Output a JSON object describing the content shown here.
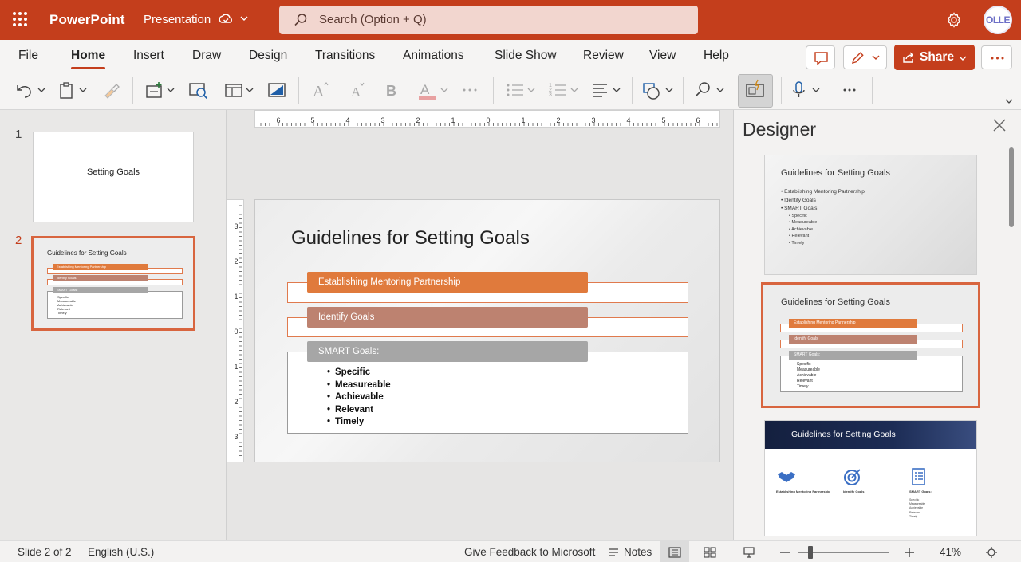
{
  "titlebar": {
    "app_name": "PowerPoint",
    "doc_name": "Presentation",
    "search_placeholder": "Search (Option + Q)",
    "avatar_initials": "OLLE",
    "accent": "#c43e1c"
  },
  "menu": {
    "tabs": [
      "File",
      "Home",
      "Insert",
      "Draw",
      "Design",
      "Transitions",
      "Animations",
      "Slide Show",
      "Review",
      "View",
      "Help"
    ],
    "active_tab": "Home",
    "share_label": "Share"
  },
  "ribbon": {
    "icons": [
      "undo-icon",
      "paste-icon",
      "format-painter-icon",
      "new-slide-icon",
      "reuse-slides-icon",
      "layout-icon",
      "background-icon",
      "increase-font-icon",
      "decrease-font-icon",
      "bold-icon",
      "font-color-icon",
      "more-font-icon",
      "bullets-icon",
      "numbering-icon",
      "align-icon",
      "shapes-icon",
      "find-icon",
      "designer-icon",
      "dictate-icon",
      "more-icon"
    ]
  },
  "thumbnails": [
    {
      "number": "1",
      "title": "Setting Goals"
    },
    {
      "number": "2",
      "title": "Guidelines for Setting Goals",
      "items": [
        "Establishing Mentoring Partnership",
        "Identify Goals",
        "SMART Goals:"
      ],
      "bullets": [
        "Specific",
        "Measureable",
        "Achievable",
        "Relevant",
        "Timely"
      ]
    }
  ],
  "ruler": {
    "h_ticks": [
      "6",
      "5",
      "4",
      "3",
      "2",
      "1",
      "0",
      "1",
      "2",
      "3",
      "4",
      "5",
      "6"
    ],
    "v_ticks": [
      "3",
      "2",
      "1",
      "0",
      "1",
      "2",
      "3"
    ]
  },
  "slide": {
    "title": "Guidelines for Setting Goals",
    "item1": "Establishing Mentoring Partnership",
    "item2": "Identify Goals",
    "item3": "SMART Goals:",
    "bullets": [
      "Specific",
      "Measureable",
      "Achievable",
      "Relevant",
      "Timely"
    ],
    "colors": {
      "item1": "#e07a3c",
      "item2": "#bd8270",
      "item3": "#a6a6a6"
    }
  },
  "designer": {
    "title": "Designer",
    "card1": {
      "title": "Guidelines for Setting Goals",
      "lines": [
        "• Establishing Mentoring Partnership",
        "• Identify Goals",
        "• SMART Goals:"
      ],
      "sublines": [
        "• Specific",
        "• Measureable",
        "• Achievable",
        "• Relevant",
        "• Timely"
      ]
    },
    "card2": {
      "title": "Guidelines for Setting Goals",
      "items": [
        "Establishing Mentoring Partnership",
        "Identify Goals",
        "SMART Goals:"
      ],
      "bullets": [
        "Specific",
        "Measureable",
        "Achievable",
        "Relevant",
        "Timely"
      ]
    },
    "card3": {
      "title": "Guidelines for Setting Goals",
      "cols": [
        "Establishing Mentoring Partnership",
        "Identify Goals",
        "SMART Goals:"
      ],
      "bullets": [
        "Specific",
        "Measureable",
        "Achievable",
        "Relevant",
        "Timely"
      ]
    }
  },
  "status": {
    "slide_info": "Slide 2 of 2",
    "language": "English (U.S.)",
    "feedback": "Give Feedback to Microsoft",
    "notes": "Notes",
    "zoom": "41%"
  }
}
